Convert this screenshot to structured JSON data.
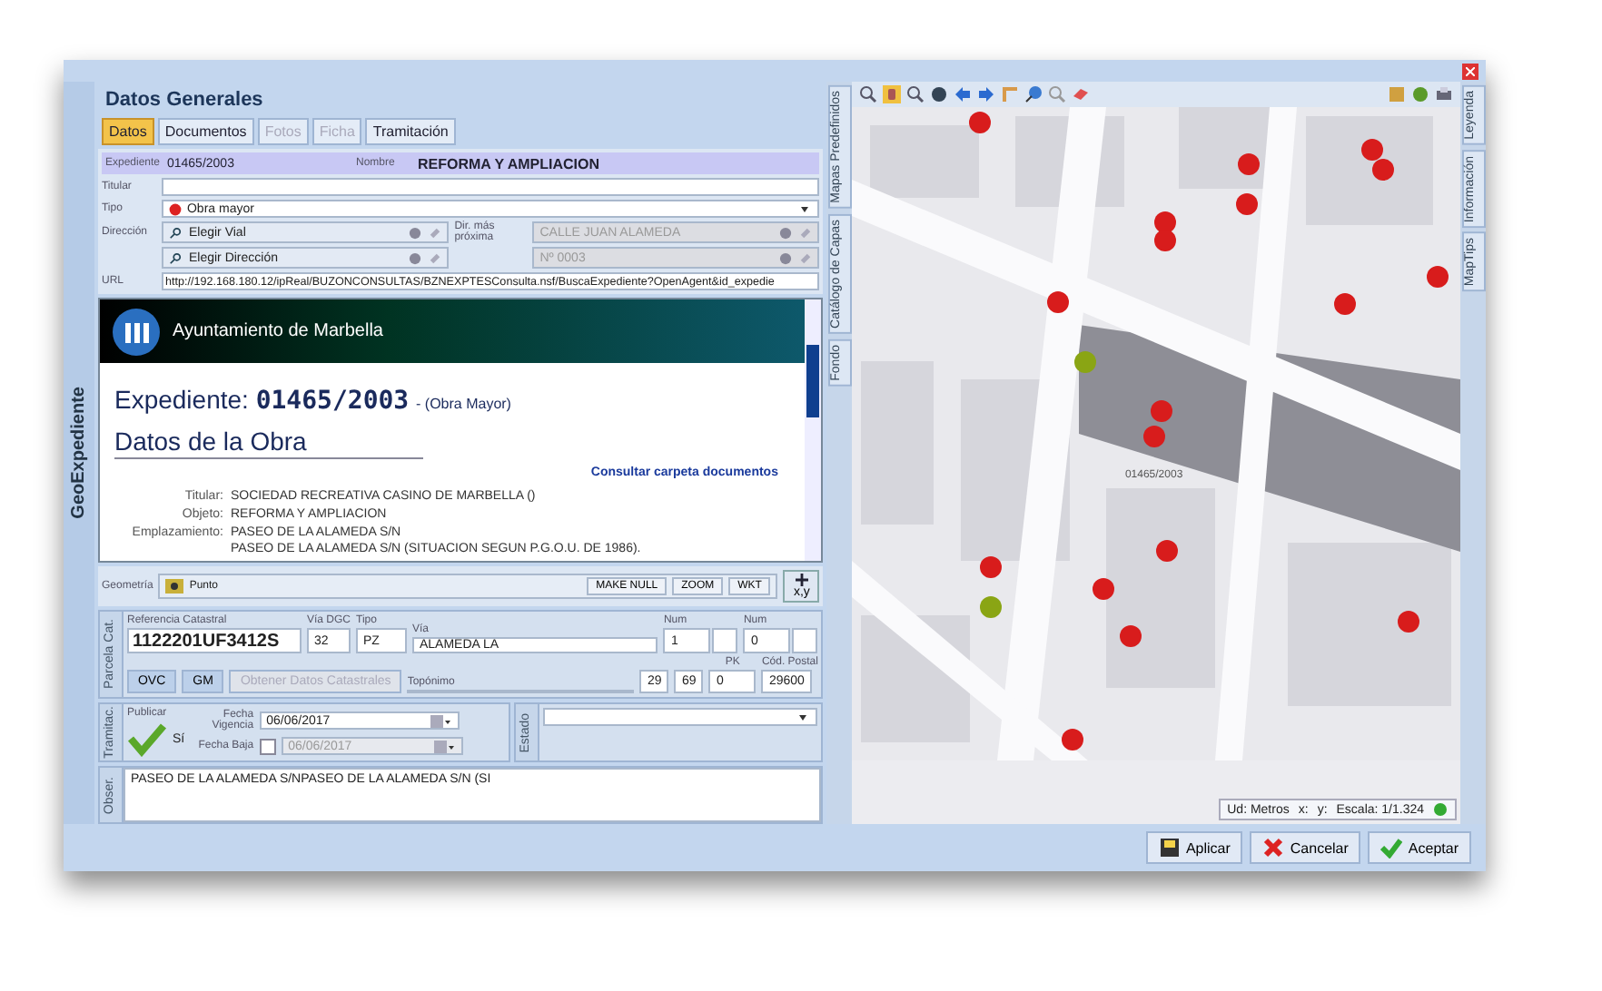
{
  "window": {
    "title": "Datos Generales",
    "side_tab": "GeoExpediente"
  },
  "tabs": [
    {
      "label": "Datos",
      "selected": true,
      "disabled": false
    },
    {
      "label": "Documentos",
      "selected": false,
      "disabled": false
    },
    {
      "label": "Fotos",
      "selected": false,
      "disabled": true
    },
    {
      "label": "Ficha",
      "selected": false,
      "disabled": true
    },
    {
      "label": "Tramitación",
      "selected": false,
      "disabled": false
    }
  ],
  "header_fields": {
    "expediente_label": "Expediente",
    "expediente": "01465/2003",
    "nombre_label": "Nombre",
    "nombre": "REFORMA  Y AMPLIACION",
    "titular_label": "Titular",
    "tipo_label": "Tipo",
    "tipo": "Obra mayor",
    "direccion_label": "Dirección",
    "vial": "Elegir Vial",
    "direccion": "Elegir Dirección",
    "dir_proxima_label": "Dir. más próxima",
    "dir_proxima": "CALLE JUAN ALAMEDA",
    "numero": "Nº 0003",
    "url_label": "URL",
    "url": "http://192.168.180.12/ipReal/BUZONCONSULTAS/BZNEXPTESConsulta.nsf/BuscaExpediente?OpenAgent&id_expedie"
  },
  "browser": {
    "banner": "Ayuntamiento de Marbella",
    "heading_label": "Expediente:",
    "heading_number": "01465/2003",
    "heading_suffix": "- (Obra Mayor)",
    "section": "Datos de la Obra",
    "link": "Consultar carpeta documentos",
    "rows": [
      {
        "label": "Titular:",
        "lines": [
          "SOCIEDAD RECREATIVA CASINO DE MARBELLA ()"
        ]
      },
      {
        "label": "Objeto:",
        "lines": [
          "REFORMA Y AMPLIACION"
        ]
      },
      {
        "label": "Emplazamiento:",
        "lines": [
          "PASEO DE LA ALAMEDA S/N",
          "PASEO DE LA ALAMEDA S/N (SITUACION SEGUN P.G.O.U. DE 1986)."
        ]
      }
    ]
  },
  "geometry": {
    "label": "Geometría",
    "value": "Punto",
    "buttons": [
      "MAKE NULL",
      "ZOOM",
      "WKT"
    ],
    "xy_button": "x,y"
  },
  "parcela": {
    "tab": "Parcela Cat.",
    "ref_label": "Referencia Catastral",
    "ref": "1122201UF3412S",
    "via_dgc_label": "Vía DGC",
    "via_dgc": "32",
    "tipo_label": "Tipo",
    "tipo": "PZ",
    "via_label": "Vía",
    "via": "ALAMEDA LA",
    "num1_label": "Num",
    "num1": "1",
    "num2_label": "Num",
    "num2": "0",
    "buttons": [
      {
        "label": "OVC",
        "disabled": false
      },
      {
        "label": "GM",
        "disabled": false
      },
      {
        "label": "Obtener Datos Catastrales",
        "disabled": true
      }
    ],
    "toponimo_label": "Topónimo",
    "field_a": "29",
    "field_b": "69",
    "pk_label": "PK",
    "pk": "0",
    "cp_label": "Cód. Postal",
    "cp": "29600"
  },
  "tramitacion": {
    "tab": "Tramitac.",
    "publicar_label": "Publicar",
    "publicar_checked": true,
    "publicar_text": "Sí",
    "vigencia_label": "Fecha Vigencia",
    "vigencia": "06/06/2017",
    "baja_label": "Fecha Baja",
    "baja_checked": false,
    "baja": "06/06/2017"
  },
  "estado": {
    "tab": "Estado"
  },
  "observaciones": {
    "tab": "Obser.",
    "text": "PASEO DE LA ALAMEDA S/NPASEO DE LA ALAMEDA S/N (SI"
  },
  "map": {
    "left_tabs": [
      "Mapas Predefinidos",
      "Catálogo de Capas",
      "Fondo"
    ],
    "right_tabs": [
      "Leyenda",
      "Información",
      "MapTips"
    ],
    "label": "01465/2003",
    "markers": [
      {
        "color": "#d81c1c"
      },
      {
        "color": "#d81c1c"
      },
      {
        "color": "#d81c1c"
      },
      {
        "color": "#d81c1c"
      },
      {
        "color": "#d81c1c"
      },
      {
        "color": "#d81c1c"
      },
      {
        "color": "#d81c1c"
      },
      {
        "color": "#d81c1c"
      },
      {
        "color": "#d81c1c"
      },
      {
        "color": "#d81c1c"
      },
      {
        "color": "#8aa514"
      },
      {
        "color": "#d81c1c"
      },
      {
        "color": "#d81c1c"
      },
      {
        "color": "#d81c1c"
      },
      {
        "color": "#d81c1c"
      },
      {
        "color": "#8aa514"
      },
      {
        "color": "#d81c1c"
      },
      {
        "color": "#d81c1c"
      },
      {
        "color": "#d81c1c"
      },
      {
        "color": "#d81c1c"
      }
    ],
    "status": {
      "units": "Ud: Metros",
      "x": "x:",
      "y": "y:",
      "scale": "Escala: 1/1.324"
    }
  },
  "buttons": [
    {
      "kind": "apply",
      "label": "Aplicar"
    },
    {
      "kind": "cancel",
      "label": "Cancelar"
    },
    {
      "kind": "accept",
      "label": "Aceptar"
    }
  ]
}
